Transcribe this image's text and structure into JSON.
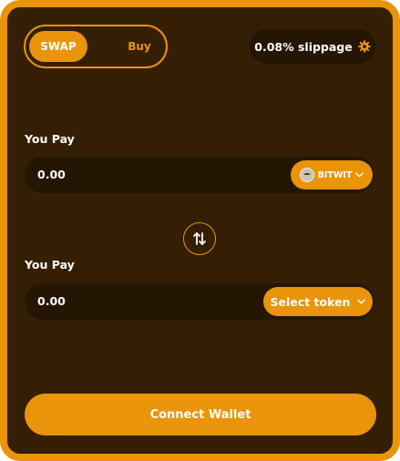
{
  "tabs": {
    "swap_label": "SWAP",
    "buy_label": "Buy"
  },
  "slippage": {
    "label": "0.08% slippage",
    "icon": "gear-icon"
  },
  "pay": {
    "label": "You Pay",
    "amount": "0.00",
    "token": {
      "symbol": "BITWIT",
      "icon": "bitwit-token-icon"
    }
  },
  "receive": {
    "label": "You Pay",
    "amount": "0.00",
    "select_label": "Select token"
  },
  "swap_direction": {
    "icon": "swap-arrows-icon"
  },
  "connect_label": "Connect Wallet",
  "colors": {
    "accent": "#e9940a",
    "background": "#341f05",
    "field": "#251604"
  }
}
